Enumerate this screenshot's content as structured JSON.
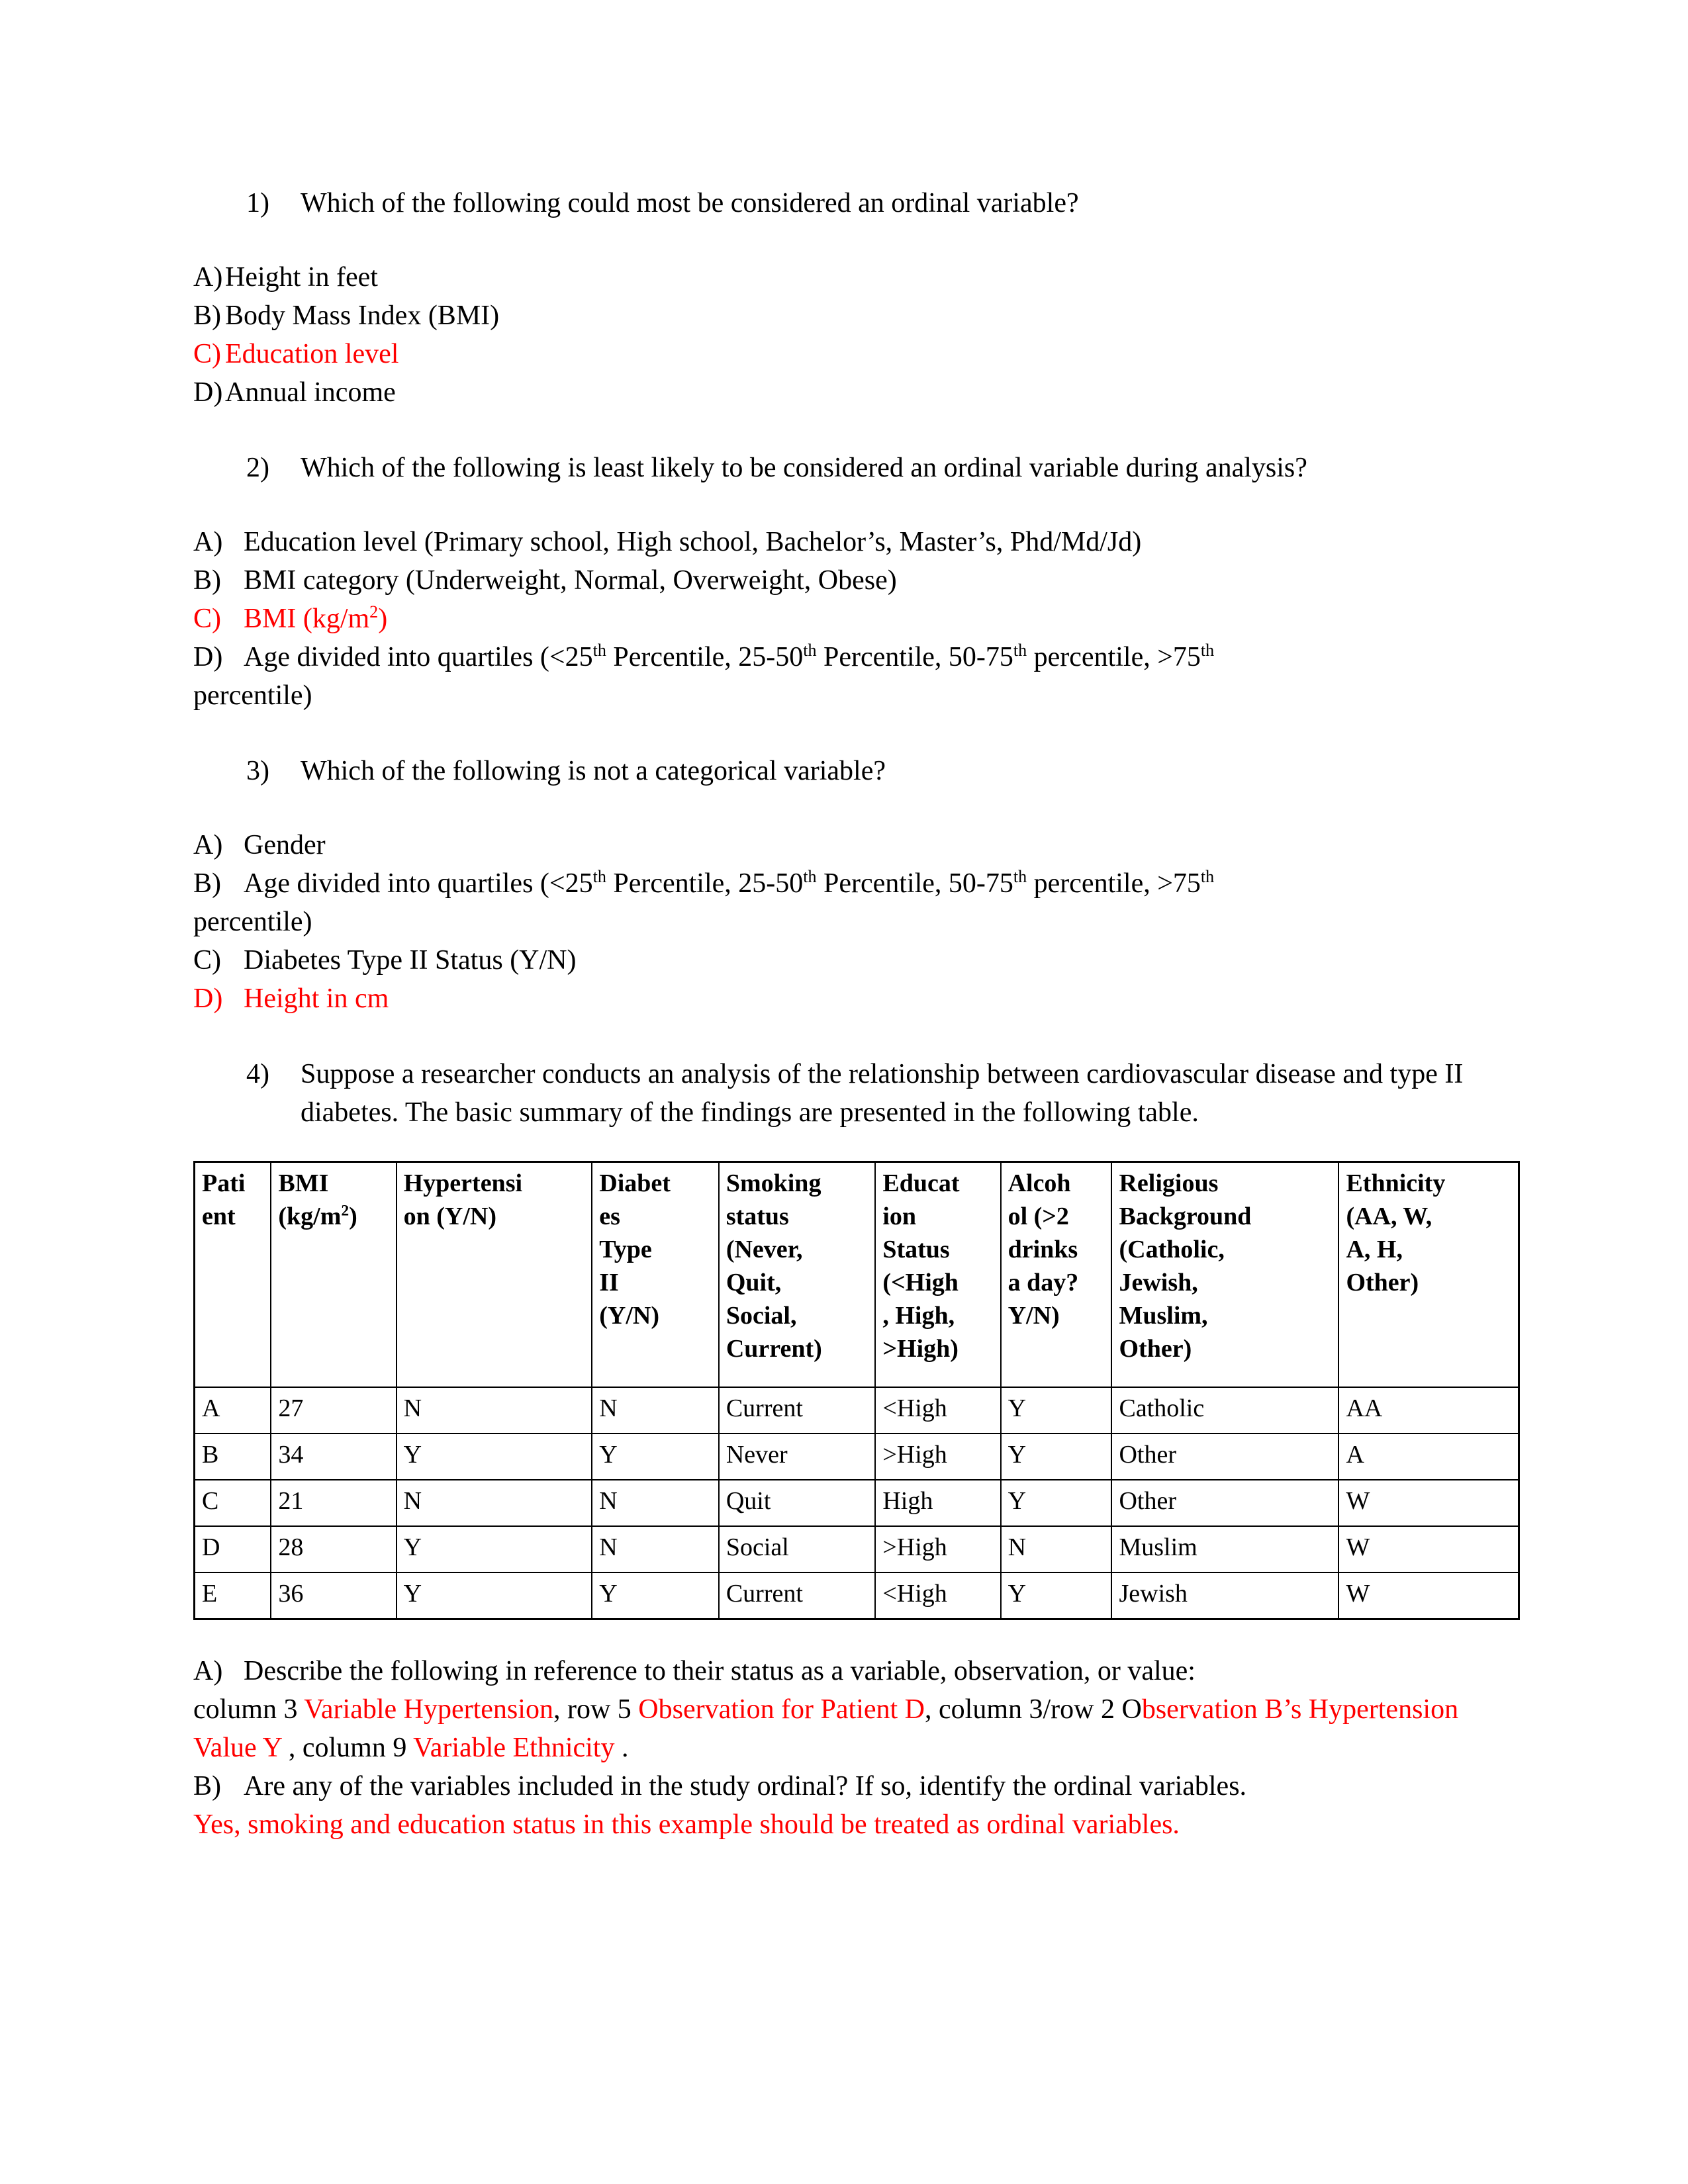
{
  "colors": {
    "answer_red": "#ff0000",
    "text_black": "#000000"
  },
  "questions": [
    {
      "number": "1)",
      "text": "Which of the following could most be considered an ordinal variable?",
      "options": [
        {
          "letter": "A)",
          "text": "Height in feet",
          "color": "black"
        },
        {
          "letter": "B)",
          "text": "Body Mass Index (BMI)",
          "color": "black"
        },
        {
          "letter": "C)",
          "text": "Education level",
          "color": "red"
        },
        {
          "letter": "D)",
          "text": "Annual income",
          "color": "black"
        }
      ]
    },
    {
      "number": "2)",
      "text": "Which of the following is least likely to be considered an ordinal variable during analysis?",
      "options": [
        {
          "letter": "A)",
          "text": "Education level (Primary school, High school, Bachelor’s, Master’s, Phd/Md/Jd)",
          "color": "black"
        },
        {
          "letter": "B)",
          "text": "BMI category (Underweight, Normal, Overweight, Obese)",
          "color": "black"
        },
        {
          "letter": "C)",
          "text": "BMI (kg/m2)",
          "color": "red"
        },
        {
          "letter": "D)",
          "text": "Age divided into quartiles (<25th Percentile, 25-50th Percentile, 50-75th percentile, >75th percentile)",
          "color": "black"
        }
      ]
    },
    {
      "number": "3)",
      "text": "Which of the following is not a categorical variable?",
      "options": [
        {
          "letter": "A)",
          "text": "Gender",
          "color": "black"
        },
        {
          "letter": "B)",
          "text": "Age divided into quartiles (<25th Percentile, 25-50th Percentile, 50-75th percentile, >75th percentile)",
          "color": "black"
        },
        {
          "letter": "C)",
          "text": "Diabetes Type II Status (Y/N)",
          "color": "black"
        },
        {
          "letter": "D)",
          "text": "Height in cm",
          "color": "red"
        }
      ]
    },
    {
      "number": "4)",
      "text": "Suppose a researcher conducts an analysis of the relationship between cardiovascular disease and type II diabetes. The basic summary of the findings are presented in the following table."
    }
  ],
  "q2_option_d_line2": "percentile)",
  "q3_option_b_line2": "percentile)",
  "q1_option_a": "A) Height in feet",
  "table": {
    "headers": [
      "Patient",
      "BMI (kg/m2)",
      "Hypertension (Y/N)",
      "Diabetes Type II (Y/N)",
      "Smoking status (Never, Quit, Social, Current)",
      "Education Status (<High, High, >High)",
      "Alcohol (>2 drinks a day? Y/N)",
      "Religious Background (Catholic, Jewish, Muslim, Other)",
      "Ethnicity (AA, W, A, H, Other)"
    ],
    "header_parts": {
      "h1_a": "Pati",
      "h1_b": "ent",
      "h2_a": "BMI",
      "h2_b": "(kg/m",
      "h2_sup": "2",
      "h2_c": ")",
      "h3_a": "Hypertensi",
      "h3_b": "on (Y/N)",
      "h4_a": "Diabet",
      "h4_b": "es",
      "h4_c": "Type",
      "h4_d": "II",
      "h4_e": "(Y/N)",
      "h5_a": "Smoking",
      "h5_b": "status",
      "h5_c": "(Never,",
      "h5_d": "Quit,",
      "h5_e": "Social,",
      "h5_f": "Current)",
      "h6_a": "Educat",
      "h6_b": "ion",
      "h6_c": "Status",
      "h6_d": "(<High",
      "h6_e": ", High,",
      "h6_f": ">High)",
      "h7_a": "Alcoh",
      "h7_b": "ol (>2",
      "h7_c": "drinks",
      "h7_d": "a day?",
      "h7_e": "Y/N)",
      "h8_a": "Religious",
      "h8_b": "Background",
      "h8_c": "(Catholic,",
      "h8_d": "Jewish,",
      "h8_e": "Muslim,",
      "h8_f": "Other)",
      "h9_a": "Ethnicity",
      "h9_b": "(AA, W,",
      "h9_c": "A, H,",
      "h9_d": "Other)"
    },
    "rows": [
      {
        "patient": "A",
        "bmi": "27",
        "hypertension": "N",
        "diabetes": "N",
        "smoking": "Current",
        "education": "<High",
        "alcohol": "Y",
        "religion": "Catholic",
        "ethnicity": "AA"
      },
      {
        "patient": "B",
        "bmi": "34",
        "hypertension": "Y",
        "diabetes": "Y",
        "smoking": "Never",
        "education": ">High",
        "alcohol": "Y",
        "religion": "Other",
        "ethnicity": "A"
      },
      {
        "patient": "C",
        "bmi": "21",
        "hypertension": "N",
        "diabetes": "N",
        "smoking": "Quit",
        "education": "High",
        "alcohol": "Y",
        "religion": "Other",
        "ethnicity": "W"
      },
      {
        "patient": "D",
        "bmi": "28",
        "hypertension": "Y",
        "diabetes": "N",
        "smoking": "Social",
        "education": ">High",
        "alcohol": "N",
        "religion": "Muslim",
        "ethnicity": "W"
      },
      {
        "patient": "E",
        "bmi": "36",
        "hypertension": "Y",
        "diabetes": "Y",
        "smoking": "Current",
        "education": "<High",
        "alcohol": "Y",
        "religion": "Jewish",
        "ethnicity": "W"
      }
    ]
  },
  "sub_questions": {
    "a_letter": "A)",
    "a_prompt": "Describe the following in reference to their status as a variable, observation, or value:",
    "a_answer": {
      "p1_black": "column 3 ",
      "p2_red": "Variable Hypertension",
      "p3_black": ", row 5 ",
      "p4_red": "Observation for Patient D",
      "p5_black": ", column 3/row 2 O",
      "p6_red": "bservation B’s Hypertension Value Y ",
      "p7_black": ", column 9 ",
      "p8_red": "Variable Ethnicity",
      "p9_black": " ."
    },
    "b_letter": "B)",
    "b_prompt": "Are any of the variables included in the study ordinal? If so, identify the ordinal variables.",
    "b_answer": "Yes, smoking and education status in this example should be treated as ordinal variables."
  }
}
